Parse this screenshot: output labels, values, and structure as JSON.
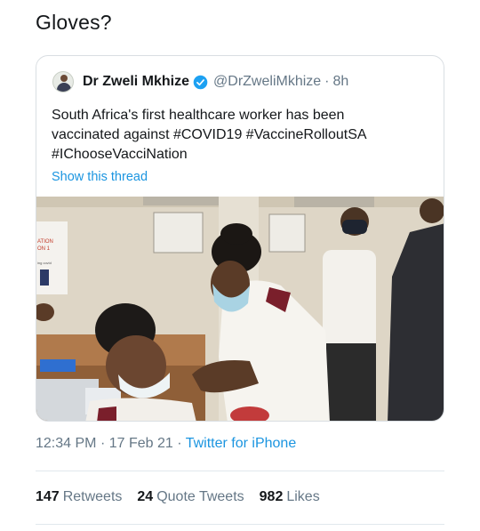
{
  "tweet": {
    "text": "Gloves?"
  },
  "quoted_tweet": {
    "author_name": "Dr Zweli Mkhize",
    "author_handle": "@DrZweliMkhize",
    "separator": "·",
    "time_ago": "8h",
    "text_lines": [
      "South Africa's first healthcare worker has been",
      "vaccinated against #COVID19 #VaccineRolloutSA",
      "#IChooseVacciNation"
    ],
    "show_thread": "Show this thread",
    "poster_text": {
      "line1": "ATION",
      "line2": "ON 1",
      "line3": "ing covid"
    }
  },
  "meta": {
    "time": "12:34 PM",
    "sep1": "·",
    "date": "17 Feb 21",
    "sep2": "·",
    "source": "Twitter for iPhone"
  },
  "stats": {
    "retweets_count": "147",
    "retweets_label": "Retweets",
    "quotes_count": "24",
    "quotes_label": "Quote Tweets",
    "likes_count": "982",
    "likes_label": "Likes"
  },
  "colors": {
    "link": "#1b95e0",
    "secondary_text": "#657786",
    "verified": "#1da1f2"
  }
}
